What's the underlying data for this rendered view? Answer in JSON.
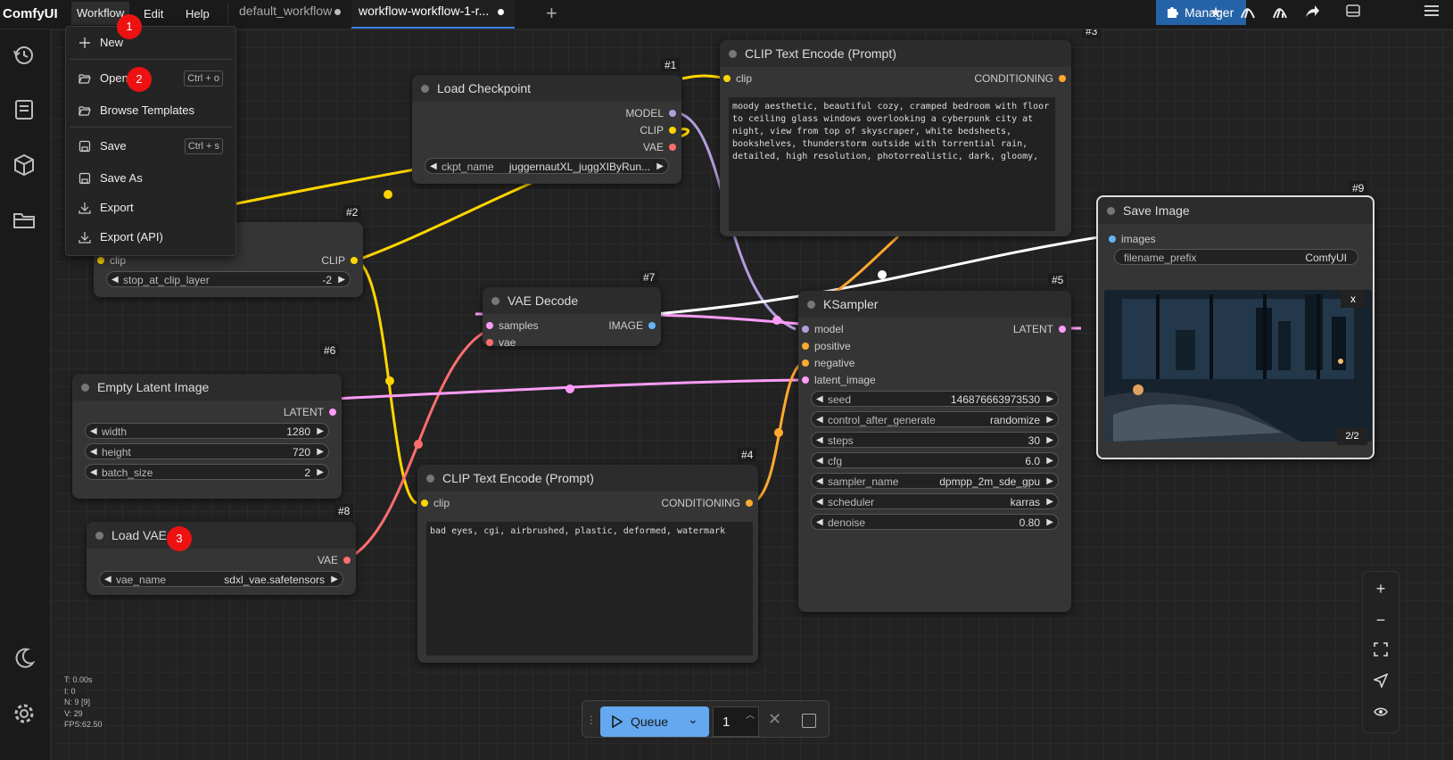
{
  "app": {
    "title": "ComfyUI"
  },
  "menu": {
    "workflow": "Workflow",
    "edit": "Edit",
    "help": "Help"
  },
  "tabs": [
    {
      "label": "default_workflow"
    },
    {
      "label": "workflow-workflow-1-r..."
    }
  ],
  "toolbar": {
    "manager_label": "Manager"
  },
  "dropdown": {
    "new": "New",
    "open": "Open",
    "open_shortcut": "Ctrl + o",
    "browse_templates": "Browse Templates",
    "save": "Save",
    "save_shortcut": "Ctrl + s",
    "save_as": "Save As",
    "export": "Export",
    "export_api": "Export (API)"
  },
  "markers": [
    "1",
    "2",
    "3"
  ],
  "nodes": {
    "load_checkpoint": {
      "id": "#1",
      "title": "Load Checkpoint",
      "outputs": [
        "MODEL",
        "CLIP",
        "VAE"
      ],
      "widget_label": "ckpt_name",
      "widget_value": "juggernautXL_juggXIByRun..."
    },
    "clip_skip": {
      "id": "#2",
      "input": "clip",
      "output": "CLIP",
      "widget_label": "stop_at_clip_layer",
      "widget_value": "-2"
    },
    "clip_pos": {
      "id": "#3",
      "title": "CLIP Text Encode (Prompt)",
      "input": "clip",
      "output": "CONDITIONING",
      "text": "moody aesthetic, beautiful cozy, cramped bedroom with floor to ceiling glass windows overlooking a cyberpunk city at night, view from top of skyscraper, white bedsheets, bookshelves, thunderstorm outside with torrential rain, detailed, high resolution, photorrealistic, dark, gloomy,"
    },
    "vae_decode": {
      "id": "#7",
      "title": "VAE Decode",
      "inputs": [
        "samples",
        "vae"
      ],
      "output": "IMAGE"
    },
    "empty_latent": {
      "id": "#6",
      "title": "Empty Latent Image",
      "output": "LATENT",
      "widgets": [
        {
          "label": "width",
          "value": "1280"
        },
        {
          "label": "height",
          "value": "720"
        },
        {
          "label": "batch_size",
          "value": "2"
        }
      ]
    },
    "load_vae": {
      "id": "#8",
      "title": "Load VAE",
      "output": "VAE",
      "widget_label": "vae_name",
      "widget_value": "sdxl_vae.safetensors"
    },
    "clip_neg": {
      "id": "#4",
      "title": "CLIP Text Encode (Prompt)",
      "input": "clip",
      "output": "CONDITIONING",
      "text": "bad eyes, cgi, airbrushed, plastic, deformed, watermark"
    },
    "ksampler": {
      "id": "#5",
      "title": "KSampler",
      "inputs": [
        "model",
        "positive",
        "negative",
        "latent_image"
      ],
      "output": "LATENT",
      "widgets": [
        {
          "label": "seed",
          "value": "146876663973530"
        },
        {
          "label": "control_after_generate",
          "value": "randomize"
        },
        {
          "label": "steps",
          "value": "30"
        },
        {
          "label": "cfg",
          "value": "6.0"
        },
        {
          "label": "sampler_name",
          "value": "dpmpp_2m_sde_gpu"
        },
        {
          "label": "scheduler",
          "value": "karras"
        },
        {
          "label": "denoise",
          "value": "0.80"
        }
      ]
    },
    "save_image": {
      "id": "#9",
      "title": "Save Image",
      "input": "images",
      "widget_label": "filename_prefix",
      "widget_value": "ComfyUI",
      "close": "x",
      "counter": "2/2"
    }
  },
  "queue": {
    "label": "Queue",
    "count": "1"
  },
  "stats": [
    "T: 0.00s",
    "I: 0",
    "N: 9 [9]",
    "V: 29",
    "FPS:62.50"
  ],
  "colors": {
    "accent": "#3b82f6",
    "clip": "#ffd500",
    "model": "#b39ddb",
    "vae": "#ff6e6e",
    "latent": "#ff9cf9",
    "image": "#64b5f6",
    "conditioning": "#ffa931"
  }
}
